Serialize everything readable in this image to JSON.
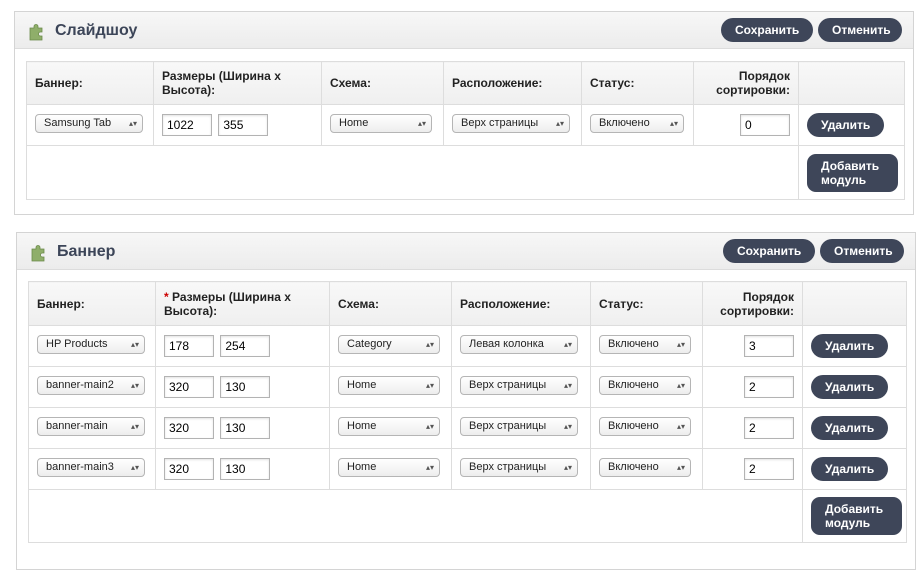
{
  "slideshow": {
    "title": "Слайдшоу",
    "icon": "puzzle-icon",
    "save_label": "Сохранить",
    "cancel_label": "Отменить",
    "headers": {
      "banner": "Баннер:",
      "dimensions": "Размеры (Ширина x Высота):",
      "layout": "Схема:",
      "position": "Расположение:",
      "status": "Статус:",
      "sort": "Порядок сортировки:"
    },
    "rows": [
      {
        "banner": "Samsung Tab",
        "width": "1022",
        "height": "355",
        "layout": "Home",
        "position": "Верх страницы",
        "status": "Включено",
        "sort": "0",
        "delete_label": "Удалить"
      }
    ],
    "add_label": "Добавить модуль"
  },
  "banner": {
    "title": "Баннер",
    "icon": "puzzle-icon",
    "save_label": "Сохранить",
    "cancel_label": "Отменить",
    "headers": {
      "banner": "Баннер:",
      "required_mark": "*",
      "dimensions": "Размеры (Ширина x Высота):",
      "layout": "Схема:",
      "position": "Расположение:",
      "status": "Статус:",
      "sort": "Порядок сортировки:"
    },
    "rows": [
      {
        "banner": "HP Products",
        "width": "178",
        "height": "254",
        "layout": "Category",
        "position": "Левая колонка",
        "status": "Включено",
        "sort": "3",
        "delete_label": "Удалить"
      },
      {
        "banner": "banner-main2",
        "width": "320",
        "height": "130",
        "layout": "Home",
        "position": "Верх страницы",
        "status": "Включено",
        "sort": "2",
        "delete_label": "Удалить"
      },
      {
        "banner": "banner-main",
        "width": "320",
        "height": "130",
        "layout": "Home",
        "position": "Верх страницы",
        "status": "Включено",
        "sort": "2",
        "delete_label": "Удалить"
      },
      {
        "banner": "banner-main3",
        "width": "320",
        "height": "130",
        "layout": "Home",
        "position": "Верх страницы",
        "status": "Включено",
        "sort": "2",
        "delete_label": "Удалить"
      }
    ],
    "add_label": "Добавить модуль"
  },
  "colors": {
    "button_bg": "#3e4659",
    "button_text": "#ffffff",
    "title_color": "#3c4558",
    "required_mark": "#cc0000",
    "puzzle_icon": "#8fae6a"
  }
}
